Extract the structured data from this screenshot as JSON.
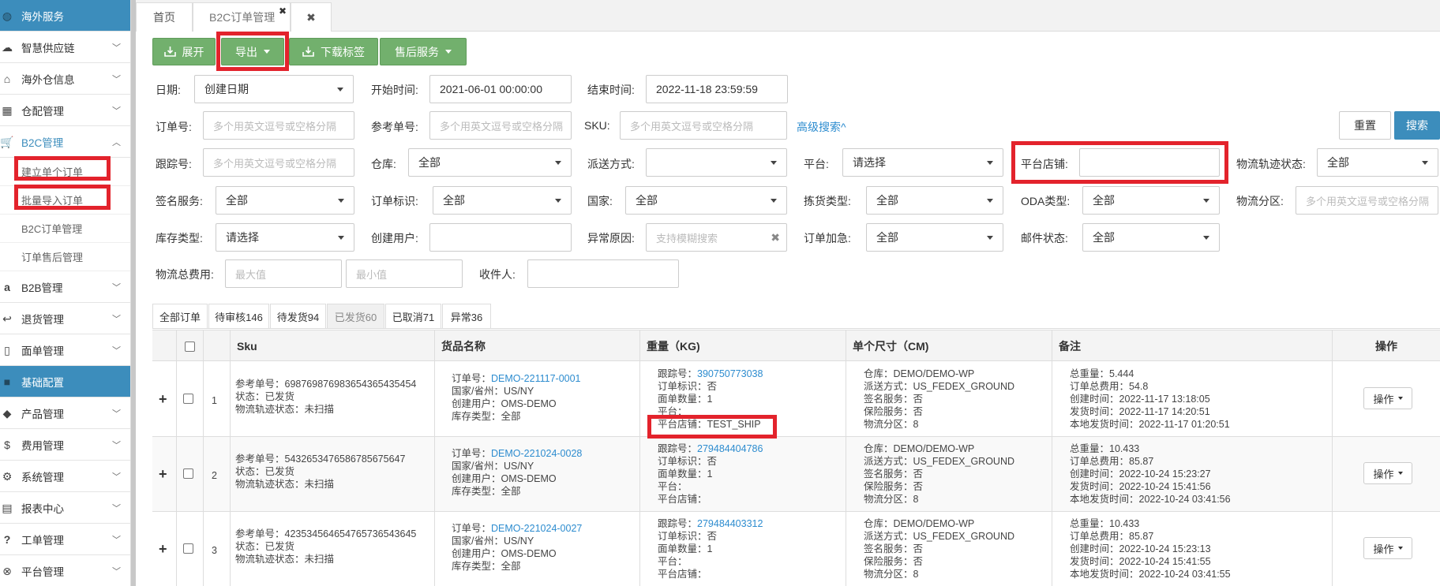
{
  "sidebar": {
    "items": [
      {
        "label": "海外服务",
        "icon": "globe-icon",
        "section": true
      },
      {
        "label": "智慧供应链",
        "icon": "cloud-icon"
      },
      {
        "label": "海外仓信息",
        "icon": "home-icon"
      },
      {
        "label": "仓配管理",
        "icon": "grid-icon"
      },
      {
        "label": "B2C管理",
        "icon": "cart-icon",
        "open": true,
        "active": true
      },
      {
        "label": "建立单个订单",
        "sub": true
      },
      {
        "label": "批量导入订单",
        "sub": true
      },
      {
        "label": "B2C订单管理",
        "sub": true
      },
      {
        "label": "订单售后管理",
        "sub": true
      },
      {
        "label": "B2B管理",
        "icon": "amazon-icon"
      },
      {
        "label": "退货管理",
        "icon": "return-icon"
      },
      {
        "label": "面单管理",
        "icon": "file-icon"
      },
      {
        "label": "基础配置",
        "icon": "folder-icon",
        "section": true
      },
      {
        "label": "产品管理",
        "icon": "tag-icon"
      },
      {
        "label": "费用管理",
        "icon": "dollar-icon"
      },
      {
        "label": "系统管理",
        "icon": "gear-icon"
      },
      {
        "label": "报表中心",
        "icon": "table-icon"
      },
      {
        "label": "工单管理",
        "icon": "question-icon"
      },
      {
        "label": "平台管理",
        "icon": "layers-icon"
      }
    ]
  },
  "tabs": {
    "home": "首页",
    "b2c": "B2C订单管理",
    "close_all": "✖",
    "close_tab": "✖"
  },
  "toolbar": {
    "expand": "展开",
    "export": "导出",
    "download_label": "下载标签",
    "after_sales": "售后服务"
  },
  "form": {
    "date_label": "日期:",
    "date_value": "创建日期",
    "start_label": "开始时间:",
    "start_value": "2021-06-01 00:00:00",
    "end_label": "结束时间:",
    "end_value": "2022-11-18 23:59:59",
    "order_no_label": "订单号:",
    "order_no_ph": "多个用英文逗号或空格分隔",
    "ref_no_label": "参考单号:",
    "ref_no_ph": "多个用英文逗号或空格分隔",
    "sku_label": "SKU:",
    "sku_ph": "多个用英文逗号或空格分隔",
    "advanced": "高级搜索^",
    "reset": "重置",
    "search": "搜索",
    "tracking_label": "跟踪号:",
    "tracking_ph": "多个用英文逗号或空格分隔",
    "warehouse_label": "仓库:",
    "warehouse_value": "全部",
    "delivery_label": "派送方式:",
    "delivery_value": "",
    "platform_label": "平台:",
    "platform_value": "请选择",
    "store_label": "平台店铺:",
    "store_value": "",
    "logistics_status_label": "物流轨迹状态:",
    "logistics_status_value": "全部",
    "sign_label": "签名服务:",
    "sign_value": "全部",
    "flag_label": "订单标识:",
    "flag_value": "全部",
    "country_label": "国家:",
    "country_value": "全部",
    "pick_label": "拣货类型:",
    "pick_value": "全部",
    "oda_label": "ODA类型:",
    "oda_value": "全部",
    "zone_label": "物流分区:",
    "zone_ph": "多个用英文逗号或空格分隔",
    "stock_type_label": "库存类型:",
    "stock_type_value": "请选择",
    "creator_label": "创建用户:",
    "creator_value": "",
    "exception_label": "异常原因:",
    "exception_ph": "支持模糊搜索",
    "urgent_label": "订单加急:",
    "urgent_value": "全部",
    "mail_label": "邮件状态:",
    "mail_value": "全部",
    "fee_label": "物流总费用:",
    "fee_max_ph": "最大值",
    "fee_min_ph": "最小值",
    "receiver_label": "收件人:",
    "receiver_value": ""
  },
  "status_tabs": [
    "全部订单",
    "待审核146",
    "待发货94",
    "已发货60",
    "已取消71",
    "异常36"
  ],
  "table": {
    "headers": {
      "sku": "Sku",
      "goods": "货品名称",
      "weight": "重量（KG)",
      "size": "单个尺寸（CM)",
      "remark": "备注",
      "action": "操作"
    },
    "rows": [
      {
        "idx": "1",
        "sku": [
          "参考单号：69876987698365436543545​4",
          "状态：已发货",
          "物流轨迹状态：未扫描"
        ],
        "order_label": "订单号：",
        "order_no": "DEMO-221117-0001",
        "goods": [
          "国家/省州：US/NY",
          "创建用户：OMS-DEMO",
          "库存类型：全部"
        ],
        "track_label": "跟踪号：",
        "track_no": "390750773038",
        "weight": [
          "订单标识：否",
          "面单数量：1",
          "平台：",
          "平台店铺：TEST_SHIP"
        ],
        "size": [
          "仓库：DEMO/DEMO-WP",
          "派送方式：US_FEDEX_GROUND",
          "签名服务：否",
          "保险服务：否",
          "物流分区：8"
        ],
        "remark": [
          "总重量：5.444",
          "订单总费用：54.8",
          "创建时间：2022-11-17 13:18:05",
          "发货时间：2022-11-17 14:20:51",
          "本地发货时间：2022-11-17 01:20:51"
        ],
        "action": "操作"
      },
      {
        "idx": "2",
        "sku": [
          "参考单号：54326534765867856756​47",
          "状态：已发货",
          "物流轨迹状态：未扫描"
        ],
        "order_label": "订单号：",
        "order_no": "DEMO-221024-0028",
        "goods": [
          "国家/省州：US/NY",
          "创建用户：OMS-DEMO",
          "库存类型：全部"
        ],
        "track_label": "跟踪号：",
        "track_no": "279484404786",
        "weight": [
          "订单标识：否",
          "面单数量：1",
          "平台：",
          "平台店铺："
        ],
        "size": [
          "仓库：DEMO/DEMO-WP",
          "派送方式：US_FEDEX_GROUND",
          "签名服务：否",
          "保险服务：否",
          "物流分区：8"
        ],
        "remark": [
          "总重量：10.433",
          "订单总费用：85.87",
          "创建时间：2022-10-24 15:23:27",
          "发货时间：2022-10-24 15:41:56",
          "本地发货时间：2022-10-24 03:41:56"
        ],
        "action": "操作"
      },
      {
        "idx": "3",
        "sku": [
          "参考单号：42353456465476573654​3645",
          "状态：已发货",
          "物流轨迹状态：未扫描"
        ],
        "order_label": "订单号：",
        "order_no": "DEMO-221024-0027",
        "goods": [
          "国家/省州：US/NY",
          "创建用户：OMS-DEMO",
          "库存类型：全部"
        ],
        "track_label": "跟踪号：",
        "track_no": "279484403312",
        "weight": [
          "订单标识：否",
          "面单数量：1",
          "平台：",
          "平台店铺："
        ],
        "size": [
          "仓库：DEMO/DEMO-WP",
          "派送方式：US_FEDEX_GROUND",
          "签名服务：否",
          "保险服务：否",
          "物流分区：8"
        ],
        "remark": [
          "总重量：10.433",
          "订单总费用：85.87",
          "创建时间：2022-10-24 15:23:13",
          "发货时间：2022-10-24 15:41:55",
          "本地发货时间：2022-10-24 03:41:55"
        ],
        "action": "操作"
      }
    ]
  },
  "colors": {
    "accent": "#3c8dbc",
    "toolbar_green": "#72b06d",
    "highlight": "#e3232c",
    "link": "#2d8ccf"
  }
}
